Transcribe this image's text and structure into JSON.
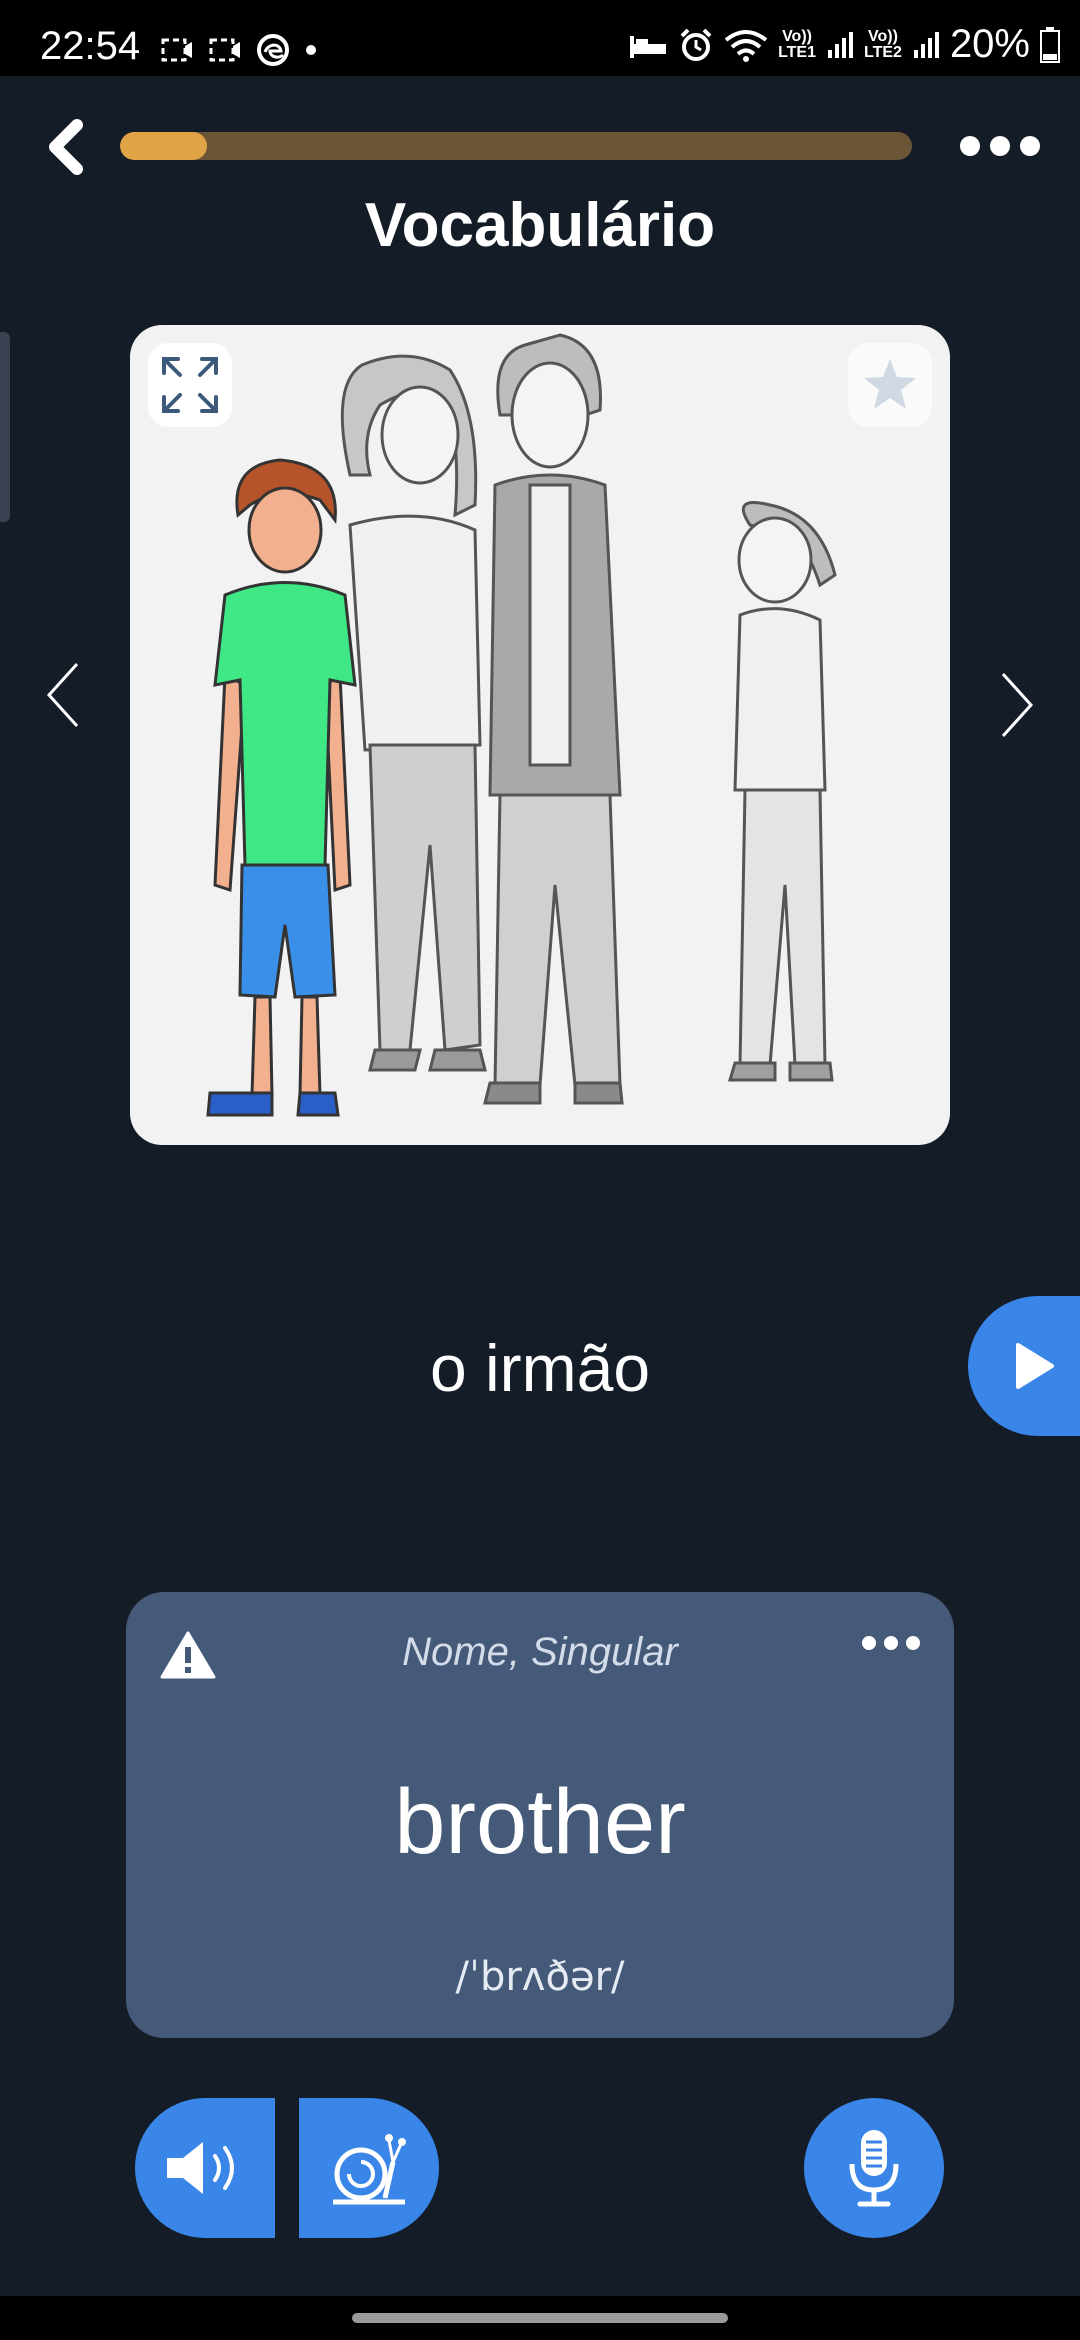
{
  "status_bar": {
    "time": "22:54",
    "battery": "20%",
    "network_1": "LTE1",
    "network_2": "LTE2",
    "volte_1": "Vo))",
    "volte_2": "Vo))"
  },
  "header": {
    "title": "Vocabulário",
    "progress": 0.11,
    "progress_color": "#e0a446",
    "track_color": "#6b5536"
  },
  "word_card": {
    "word": "o irmão"
  },
  "translation_card": {
    "part_of_speech": "Nome, Singular",
    "translation": "brother",
    "phonetic": "/ˈbrʌðər/"
  },
  "colors": {
    "background": "#141c28",
    "accent": "#3a86e8",
    "card": "#445a78"
  },
  "icons": [
    "back-arrow-icon",
    "more-icon",
    "expand-icon",
    "star-icon",
    "chevron-left-icon",
    "chevron-right-icon",
    "play-icon",
    "warning-icon",
    "speaker-icon",
    "snail-icon",
    "microphone-icon"
  ]
}
